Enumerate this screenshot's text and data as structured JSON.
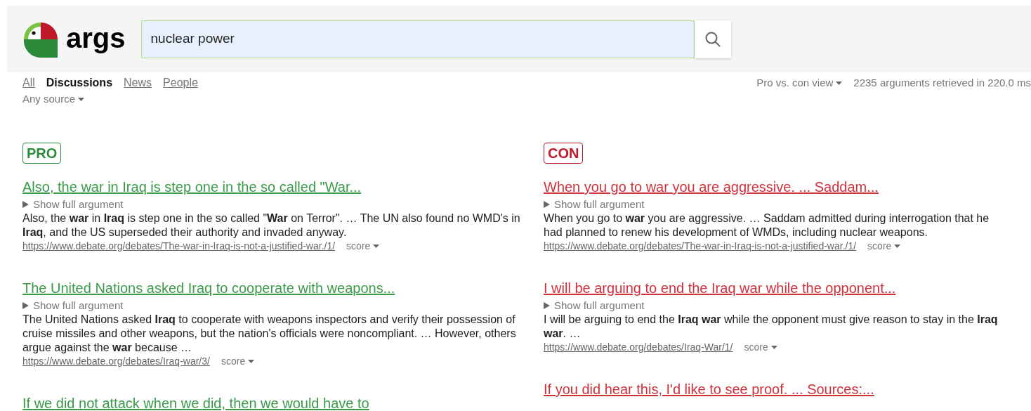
{
  "header": {
    "logo_text": "args",
    "search": {
      "value": "nuclear power"
    }
  },
  "nav_tabs": [
    {
      "label": "All",
      "selected": false
    },
    {
      "label": "Discussions",
      "selected": true
    },
    {
      "label": "News",
      "selected": false
    },
    {
      "label": "People",
      "selected": false
    }
  ],
  "source_filter": "Any source",
  "view_toggle": "Pro vs. con view",
  "stats": "2235 arguments retrieved in 220.0 ms",
  "columns": [
    {
      "label": "PRO",
      "kind": "pro",
      "items": [
        {
          "title": "Also, the war in Iraq is step one in the so called \"War...",
          "toggle": "Show full argument",
          "expanded": false,
          "snippet": "Also, the **war** in **Iraq** is step one in the so called \"**War** on Terror\". … The UN also found no WMD's in **Iraq**, and the US superseded their authority and invaded anyway.",
          "url": "https://www.debate.org/debates/The-war-in-Iraq-is-not-a-justified-war./1/",
          "score": "score"
        },
        {
          "title": "The United Nations asked Iraq to cooperate with weapons...",
          "toggle": "Show full argument",
          "expanded": false,
          "snippet": "The United Nations asked **Iraq** to cooperate with weapons inspectors and verify their possession of cruise missiles and other weapons, but the nation's officials were noncompliant. … However, others argue against the **war** because …",
          "url": "https://www.debate.org/debates/Iraq-war/3/",
          "score": "score"
        },
        {
          "title": "If we did not attack when we did, then we would have to"
        }
      ]
    },
    {
      "label": "CON",
      "kind": "con",
      "items": [
        {
          "title": "When you go to war you are aggressive. ... Saddam...",
          "toggle": "Show full argument",
          "expanded": false,
          "snippet": "When you go to **war** you are aggressive. … Saddam admitted during interrogation that he had planned to renew his development of WMDs, including nuclear weapons.",
          "url": "https://www.debate.org/debates/The-war-in-Iraq-is-not-a-justified-war./1/",
          "score": "score"
        },
        {
          "title": "I will be arguing to end the Iraq war while the opponent...",
          "toggle": "Show full argument",
          "expanded": false,
          "snippet": "I will be arguing to end the **Iraq war** while the opponent must give reason to stay in the **Iraq war**. …",
          "url": "https://www.debate.org/debates/Iraq-War/1/",
          "score": "score"
        },
        {
          "title": "If you did hear this, I'd like to see proof. ... Sources:..."
        }
      ]
    }
  ]
}
